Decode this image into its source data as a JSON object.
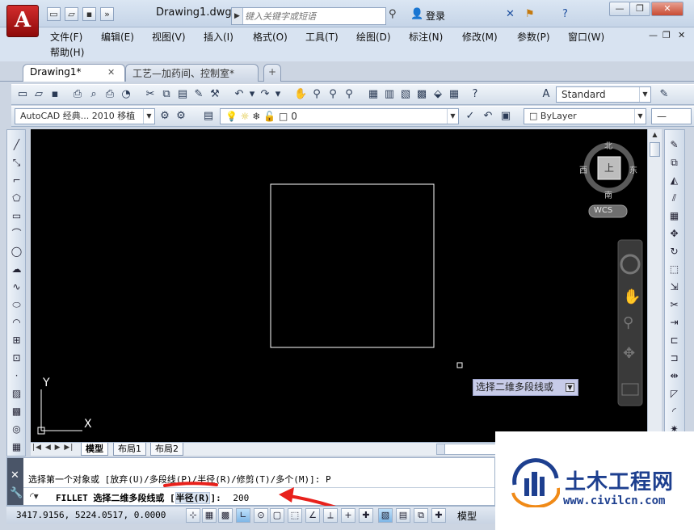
{
  "app": {
    "logo_letter": "A",
    "document_title": "Drawing1.dwg"
  },
  "search": {
    "placeholder": "键入关键字或短语"
  },
  "user": {
    "login_label": "登录"
  },
  "menu": {
    "items": [
      "文件(F)",
      "编辑(E)",
      "视图(V)",
      "插入(I)",
      "格式(O)",
      "工具(T)",
      "绘图(D)",
      "标注(N)",
      "修改(M)",
      "参数(P)",
      "窗口(W)",
      "帮助(H)"
    ]
  },
  "tabs": {
    "items": [
      "Drawing1*",
      "工艺—加药间、控制室*"
    ]
  },
  "toolbar": {
    "text_style": "Standard",
    "workspace": "AutoCAD 经典... 2010 移植",
    "layer": "0",
    "color": "ByLayer"
  },
  "viewcube": {
    "north": "北",
    "south": "南",
    "west": "西",
    "east": "东",
    "top_face": "上",
    "wcs": "WCS"
  },
  "ucs": {
    "x_label": "X",
    "y_label": "Y"
  },
  "tooltip": {
    "text": "选择二维多段线或"
  },
  "layout_tabs": {
    "items": [
      "模型",
      "布局1",
      "布局2"
    ]
  },
  "command": {
    "history_line": "选择第一个对象或 [放弃(U)/多段线(P)/半径(R)/修剪(T)/多个(M)]: P",
    "prompt_prefix": "FILLET 选择二维多段线或 [",
    "prompt_highlight": "半径(R)",
    "prompt_suffix": "]:",
    "input_value": "200"
  },
  "status": {
    "coordinates": "3417.9156, 5224.0517, 0.0000",
    "model_label": "模型"
  },
  "watermark": {
    "name": "土木工程网",
    "url": "www.civilcn.com"
  },
  "colors": {
    "canvas": "#000000",
    "annotation_red": "#e8211c",
    "watermark_blue": "#1d3f8f"
  }
}
